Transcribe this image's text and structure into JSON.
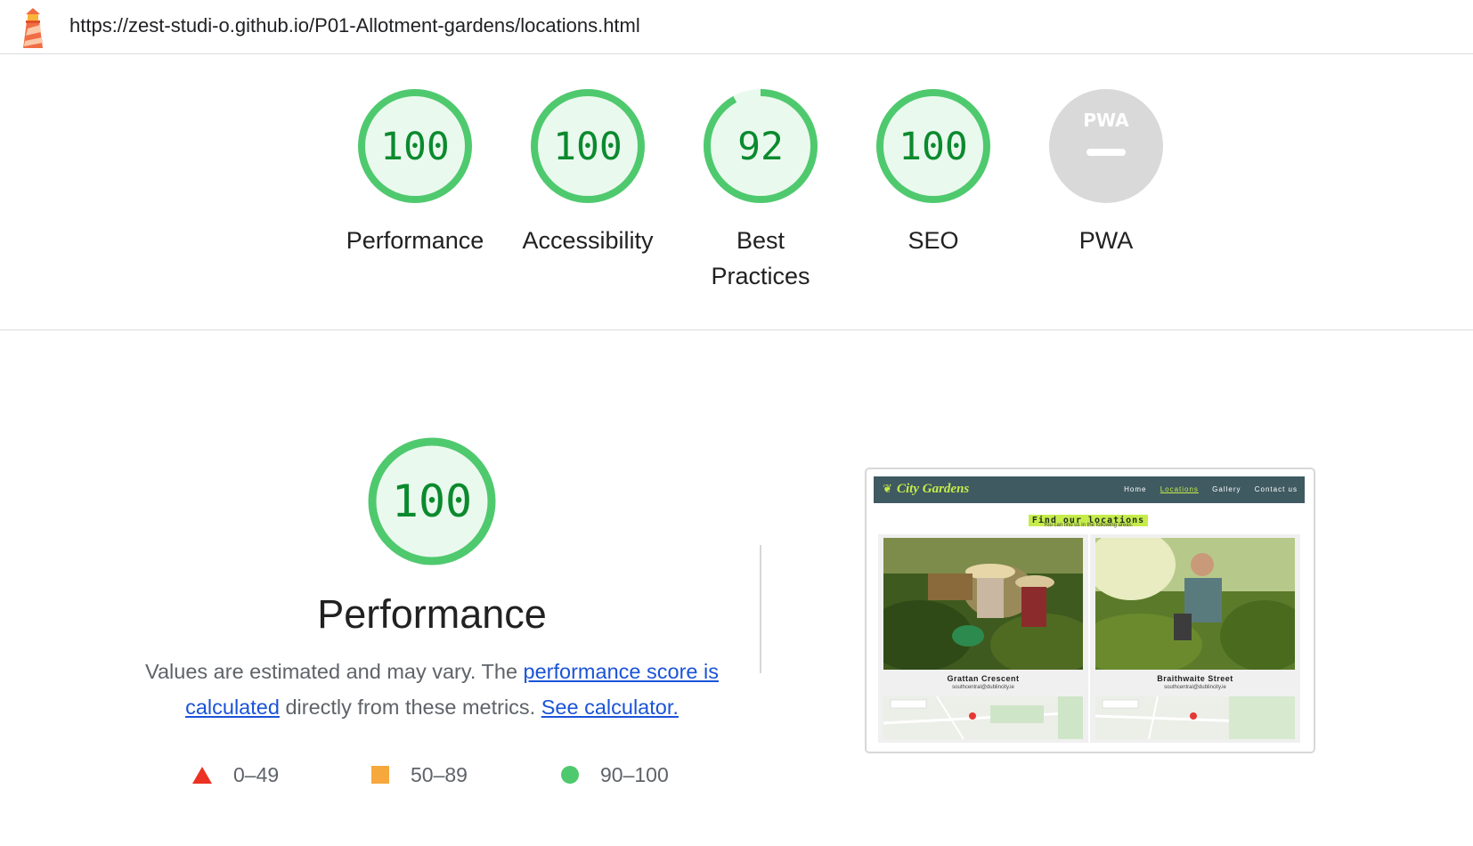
{
  "header": {
    "logo_icon": "lighthouse-icon",
    "url": "https://zest-studi-o.github.io/P01-Allotment-gardens/locations.html"
  },
  "gauges": [
    {
      "label": "Performance",
      "score": "100",
      "fraction": 1.0
    },
    {
      "label": "Accessibility",
      "score": "100",
      "fraction": 1.0
    },
    {
      "label": "Best Practices",
      "score": "92",
      "fraction": 0.92
    },
    {
      "label": "SEO",
      "score": "100",
      "fraction": 1.0
    },
    {
      "label": "PWA",
      "badge": "PWA",
      "score": "—"
    }
  ],
  "performance": {
    "score": "100",
    "title": "Performance",
    "desc_prefix": "Values are estimated and may vary. The ",
    "link_score": "performance score is calculated",
    "desc_middle": " directly from these metrics. ",
    "link_calc": "See calculator."
  },
  "legend": [
    {
      "icon": "red-triangle-icon",
      "range": "0–49"
    },
    {
      "icon": "orange-square-icon",
      "range": "50–89"
    },
    {
      "icon": "green-circle-icon",
      "range": "90–100"
    }
  ],
  "screenshot": {
    "brand": "City Gardens",
    "nav": [
      "Home",
      "Locations",
      "Gallery",
      "Contact us"
    ],
    "heading": "Find our locations",
    "subheading": "You can find us in the following areas:",
    "cards": [
      {
        "name": "Grattan Crescent",
        "email": "southcentral@dublincity.ie",
        "map_button": "View larger map"
      },
      {
        "name": "Braithwaite Street",
        "email": "southcentral@dublincity.ie",
        "map_button": "View larger map"
      }
    ]
  },
  "colors": {
    "pass_green": "#0b8a2e",
    "ring_green": "#4fc96e",
    "ring_fill": "#eaf9ee",
    "pwa_grey": "#d9d9d9",
    "link_blue": "#1a53d8",
    "site_nav": "#3f5a61",
    "site_accent": "#c6ec4b"
  }
}
